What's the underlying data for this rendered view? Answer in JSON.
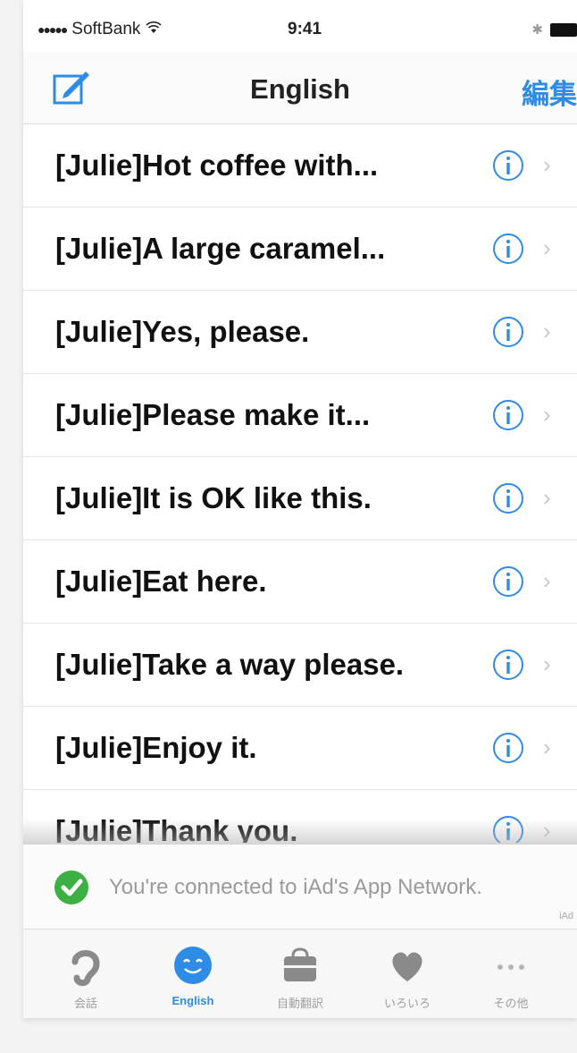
{
  "status_bar": {
    "signal_dots": "●●●●●",
    "carrier": "SoftBank",
    "time": "9:41"
  },
  "nav": {
    "title": "English",
    "edit_label": "編集"
  },
  "rows": [
    {
      "label": "[Julie]Hot coffee with..."
    },
    {
      "label": "[Julie]A large caramel..."
    },
    {
      "label": "[Julie]Yes, please."
    },
    {
      "label": "[Julie]Please make it..."
    },
    {
      "label": "[Julie]It is OK like this."
    },
    {
      "label": "[Julie]Eat here."
    },
    {
      "label": "[Julie]Take a way please."
    },
    {
      "label": "[Julie]Enjoy it."
    },
    {
      "label": "[Julie]Thank you."
    }
  ],
  "ad": {
    "text": "You're connected to iAd's App Network.",
    "marker": "iAd"
  },
  "tabs": [
    {
      "label": "会話",
      "icon": "ear-icon",
      "active": false
    },
    {
      "label": "English",
      "icon": "smiley-icon",
      "active": true
    },
    {
      "label": "自動翻訳",
      "icon": "bag-icon",
      "active": false
    },
    {
      "label": "いろいろ",
      "icon": "heart-icon",
      "active": false
    },
    {
      "label": "その他",
      "icon": "more-icon",
      "active": false
    }
  ],
  "colors": {
    "accent": "#2e8be6",
    "check": "#3cb043",
    "tab_inactive": "#a0a0a0"
  }
}
